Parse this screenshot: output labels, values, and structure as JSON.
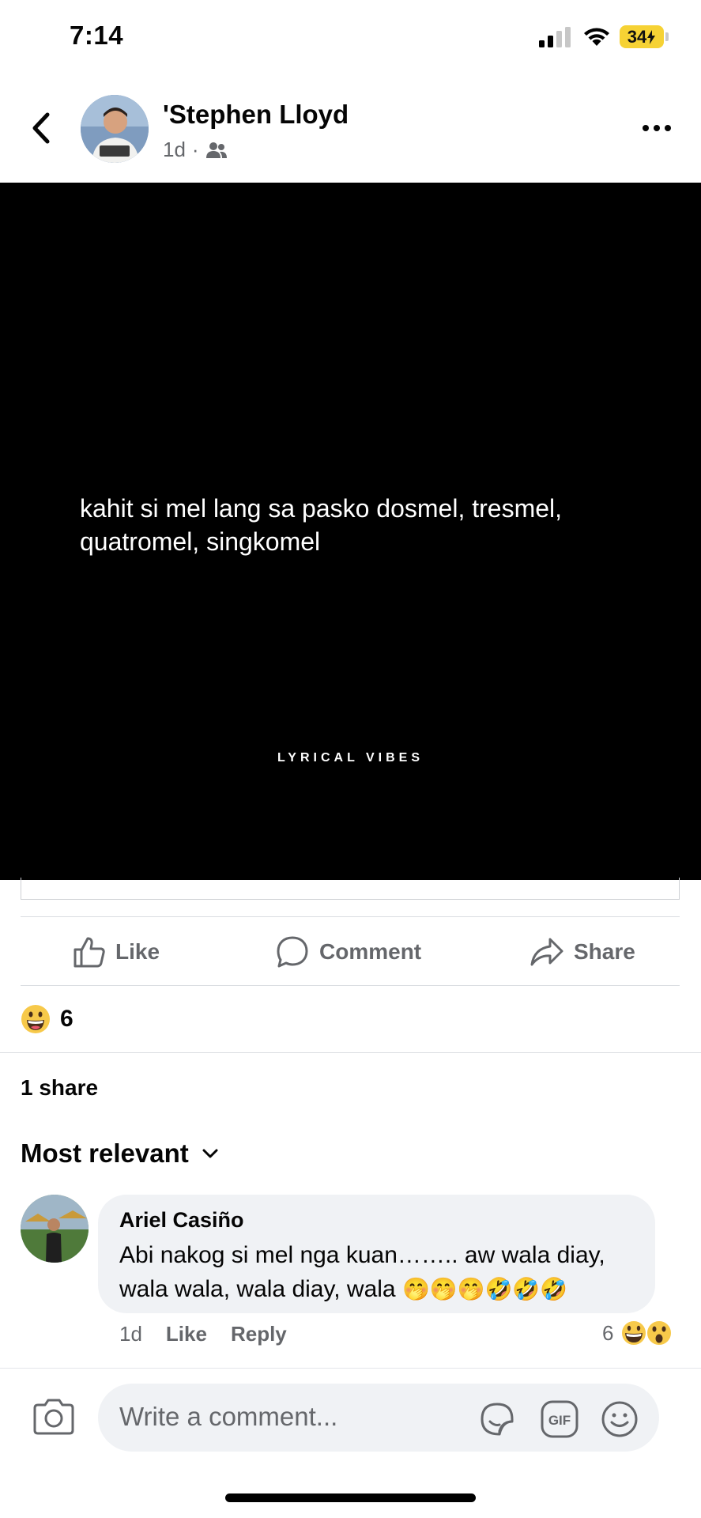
{
  "status_bar": {
    "time": "7:14",
    "battery": "34"
  },
  "post": {
    "author": "'Stephen Lloyd",
    "time": "1d",
    "separator": "·",
    "audience_icon": "friends-icon",
    "image_text": "kahit si mel lang sa pasko dosmel, tresmel, quatromel, singkomel",
    "watermark": "LYRICAL VIBES"
  },
  "actions": {
    "like": "Like",
    "comment": "Comment",
    "share": "Share"
  },
  "reactions": {
    "count": "6",
    "emoji": "grinning-face-icon"
  },
  "shares": "1 share",
  "sort": {
    "label": "Most relevant"
  },
  "comment": {
    "author": "Ariel Casiño",
    "text_line1": "Abi nakog si mel nga kuan…….. aw wala diay,",
    "text_line2": "wala wala, wala diay, wala",
    "emojis": "🤭🤭🤭🤣🤣🤣",
    "time": "1d",
    "like": "Like",
    "reply": "Reply",
    "reaction_count": "6"
  },
  "composer": {
    "placeholder": "Write a comment..."
  },
  "colors": {
    "accent_gray": "#65676b",
    "bubble": "#f0f2f5",
    "image_bg": "#000000"
  }
}
